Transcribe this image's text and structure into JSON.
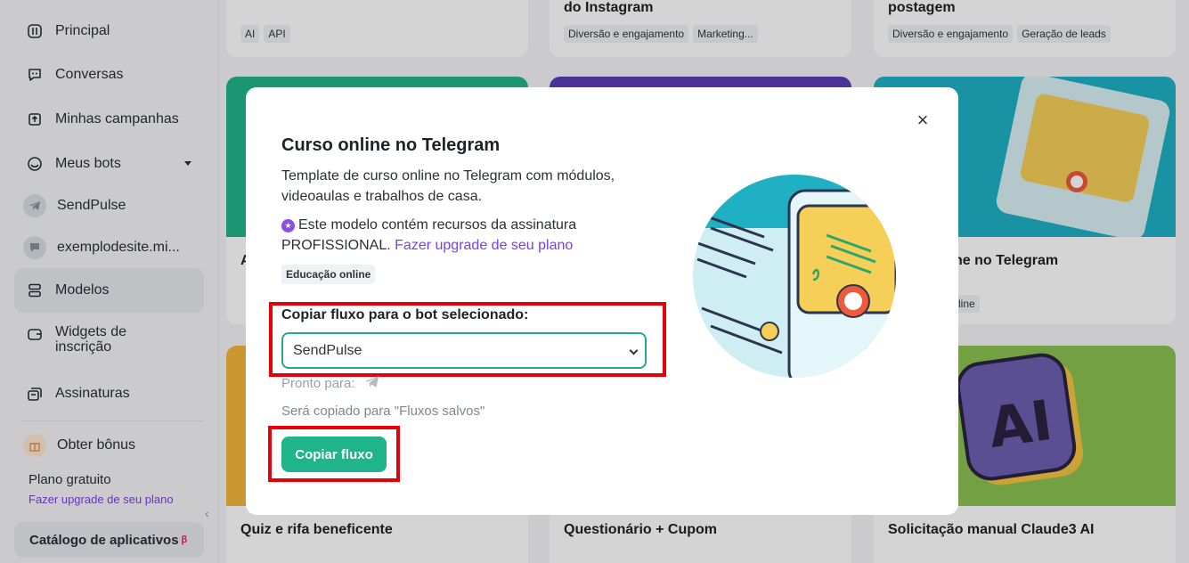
{
  "sidebar": {
    "items": [
      {
        "label": "Principal",
        "icon": "dashboard-icon"
      },
      {
        "label": "Conversas",
        "icon": "chat-icon"
      },
      {
        "label": "Minhas campanhas",
        "icon": "campaign-icon"
      },
      {
        "label": "Meus bots",
        "icon": "bot-icon"
      },
      {
        "label": "SendPulse",
        "icon": "telegram-icon"
      },
      {
        "label": "exemplodesite.mi...",
        "icon": "livechat-icon"
      },
      {
        "label": "Modelos",
        "icon": "templates-icon"
      },
      {
        "label": "Widgets de inscrição",
        "icon": "widget-icon"
      },
      {
        "label": "Assinaturas",
        "icon": "subscriptions-icon"
      },
      {
        "label": "Obter bônus",
        "icon": "gift-icon"
      }
    ],
    "plan_label": "Plano gratuito",
    "plan_upgrade_link": "Fazer upgrade de seu plano",
    "catalog_label": "Catálogo de aplicativos",
    "catalog_badge": "β"
  },
  "cards": {
    "top": [
      {
        "title": "",
        "tags": [
          "AI",
          "API"
        ]
      },
      {
        "title": "do Instagram",
        "tags": [
          "Diversão e engajamento",
          "Marketing..."
        ]
      },
      {
        "title": "postagem",
        "tags": [
          "Diversão e engajamento",
          "Geração de leads"
        ]
      }
    ],
    "middle_left_partial": "A",
    "middle_right": {
      "title_partial": "ne no Telegram",
      "tag_partial": "line"
    },
    "bottom": [
      {
        "title": "Quiz e rifa beneficente"
      },
      {
        "title": "Questionário + Cupom"
      },
      {
        "title": "Solicitação manual Claude3 AI"
      }
    ]
  },
  "modal": {
    "title": "Curso online no Telegram",
    "description": "Template de curso online no Telegram com módulos, videoaulas e trabalhos de casa.",
    "premium_text": "Este modelo contém recursos da assinatura PROFISSIONAL.",
    "premium_link": "Fazer upgrade de seu plano",
    "tag": "Educação online",
    "select_label": "Copiar fluxo para o bot selecionado:",
    "select_value": "SendPulse",
    "ready_label": "Pronto para:",
    "copied_note": "Será copiado para \"Fluxos salvos\"",
    "copy_button": "Copiar fluxo",
    "close": "×"
  },
  "colors": {
    "accent_green": "#1fb48a",
    "link_purple": "#7b3fe4",
    "highlight_red": "#e5000a",
    "select_border": "#27a88d"
  }
}
